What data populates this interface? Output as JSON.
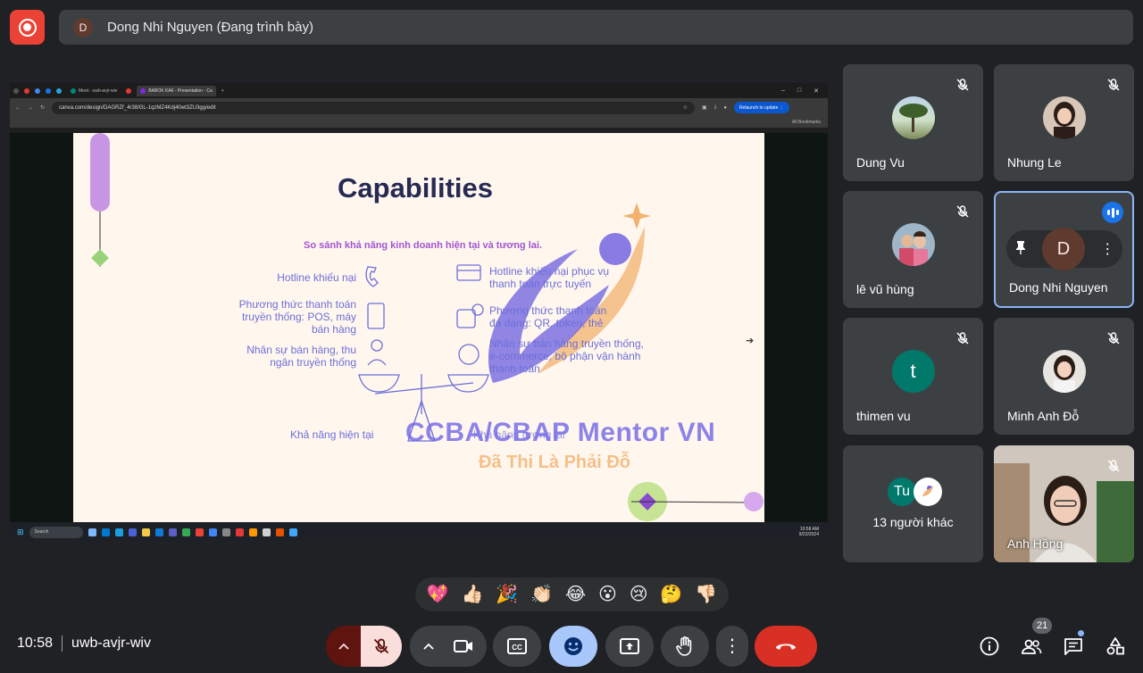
{
  "top": {
    "presenter_initial": "D",
    "presenter_label": "Dong Nhi Nguyen (Đang trình bày)"
  },
  "browser": {
    "tabs": [
      {
        "label": "Meet - uwb-avjr-wiv",
        "active": false
      },
      {
        "label": "BABOK KA6 - Presentation - Ca",
        "active": true
      }
    ],
    "url": "canva.com/design/DAGRZf_4r38/GL-1qzMZ4Kdj40wt3ZU3gg/edit",
    "relaunch_label": "Relaunch to update",
    "bookmarks_label": "All Bookmarks"
  },
  "slide": {
    "title": "Capabilities",
    "subtitle": "So sánh khả năng kinh doanh hiện tại và tương lai.",
    "left_items": [
      "Hotline khiếu nại",
      "Phương thức thanh toán truyền thống: POS, máy bán hàng",
      "Nhân sự bán hàng, thu ngân truyền thống"
    ],
    "right_items": [
      "Hotline khiếu nại phục vụ thanh toán trực tuyến",
      "Phương thức thanh toán đa dạng: QR, token, thẻ",
      "Nhân sự bán hàng truyền thống, e-commerce, bộ phận vận hành thanh toán"
    ],
    "left_caption": "Khả năng hiện tại",
    "right_caption": "Khả năng tương lai",
    "watermark_title": "CCBA/CBAP Mentor VN",
    "watermark_sub": "Đã Thi Là Phải Đỗ"
  },
  "taskbar": {
    "search_label": "Search",
    "time": "10:58 AM",
    "date": "9/22/2024"
  },
  "participants": [
    {
      "name": "Dung Vu",
      "muted": true
    },
    {
      "name": "Nhung Le",
      "muted": true
    },
    {
      "name": "lê vũ hùng",
      "muted": true
    },
    {
      "name": "Dong Nhi Nguyen",
      "initial": "D",
      "speaking": true
    },
    {
      "name": "thimen vu",
      "initial": "t",
      "muted": true
    },
    {
      "name": "Minh Anh Đỗ",
      "muted": true
    },
    {
      "name": "Anh Hồng",
      "muted": true
    }
  ],
  "others": {
    "initial": "Tu",
    "label": "13 người khác"
  },
  "reactions": [
    "💖",
    "👍🏻",
    "🎉",
    "👏🏻",
    "😂",
    "😮",
    "😢",
    "🤔",
    "👎🏻"
  ],
  "bottom": {
    "time": "10:58",
    "meeting_code": "uwb-avjr-wiv",
    "people_count": "21"
  },
  "colors": {
    "accent": "#a8c7fa",
    "hangup": "#d93025",
    "tile": "#3c4043",
    "bg": "#202124"
  }
}
